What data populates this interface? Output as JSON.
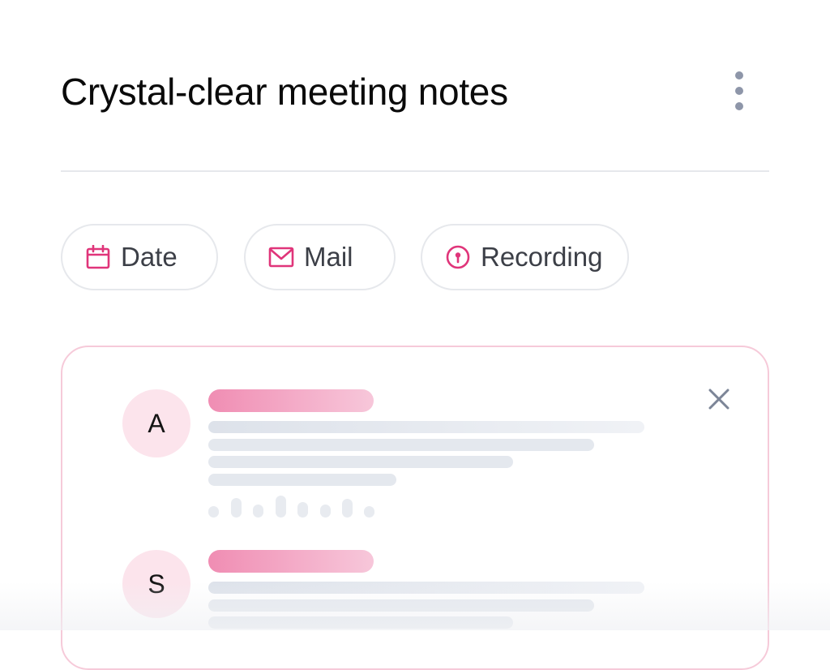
{
  "header": {
    "title": "Crystal-clear meeting notes",
    "more_icon": "more-vertical-icon"
  },
  "chips": [
    {
      "label": "Date",
      "icon": "calendar-icon"
    },
    {
      "label": "Mail",
      "icon": "mail-icon"
    },
    {
      "label": "Recording",
      "icon": "record-icon"
    }
  ],
  "card": {
    "close_icon": "close-icon",
    "entries": [
      {
        "avatar_initial": "A"
      },
      {
        "avatar_initial": "S"
      }
    ]
  },
  "colors": {
    "accent": "#e0357a",
    "avatar_bg": "#fce4ec",
    "card_border": "#f6cad9",
    "muted_icon": "#8e96a9",
    "placeholder": "#e4e8ee"
  }
}
